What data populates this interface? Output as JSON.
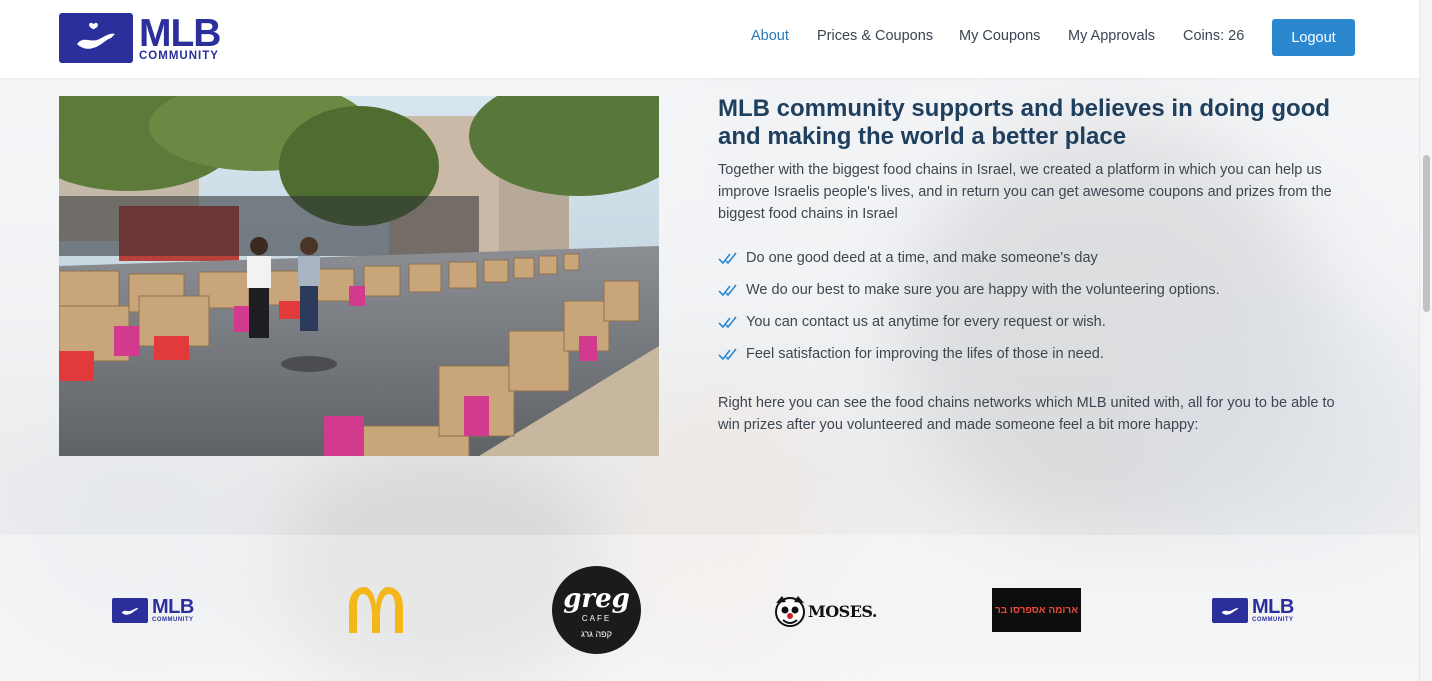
{
  "brand": {
    "name": "MLB",
    "tagline": "COMMUNITY",
    "color": "#2a2f9c"
  },
  "nav": {
    "items": [
      {
        "label": "About",
        "active": true
      },
      {
        "label": "Prices & Coupons",
        "active": false
      },
      {
        "label": "My Coupons",
        "active": false
      },
      {
        "label": "My Approvals",
        "active": false
      }
    ],
    "coins": "Coins: 26",
    "logout": "Logout"
  },
  "main": {
    "heading": "MLB community supports and believes in doing good and making the world a better place",
    "intro": "Together with the biggest food chains in Israel, we created a platform in which you can help us improve Israelis people's lives, and in return you can get awesome coupons and prizes from the biggest food chains in Israel",
    "checklist": [
      "Do one good deed at a time, and make someone's day",
      "We do our best to make sure you are happy with the volunteering options.",
      "You can contact us at anytime for every request or wish.",
      "Feel satisfaction for improving the lifes of those in need."
    ],
    "outro": "Right here you can see the food chains networks which MLB united with, all for you to be able to win prizes after you volunteered and made someone feel a bit more happy:"
  },
  "partners": {
    "mlb1": {
      "name": "MLB",
      "tagline": "COMMUNITY"
    },
    "greg": {
      "name": "greg",
      "sub": "CAFE",
      "hebrew": "קפה גרג"
    },
    "moses": {
      "name": "MOSES."
    },
    "aroma": {
      "name": "ארומה אספרסו בר"
    },
    "mlb2": {
      "name": "MLB",
      "tagline": "COMMUNITY"
    }
  },
  "colors": {
    "accent": "#2b88cf",
    "link_active": "#2b78b7",
    "heading": "#1f3f5e",
    "check": "#2b88cf"
  }
}
